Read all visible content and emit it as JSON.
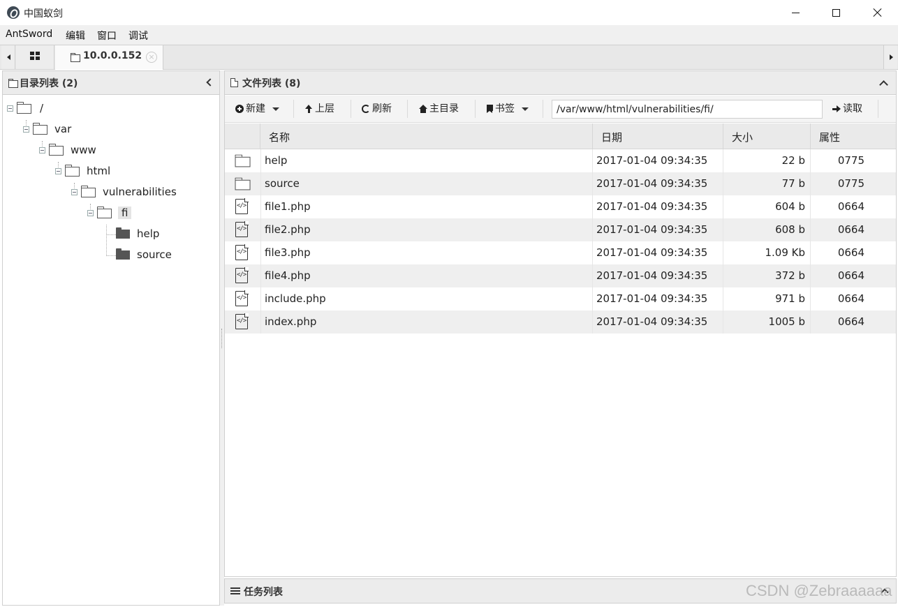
{
  "window": {
    "title": "中国蚁剑"
  },
  "menu": [
    "AntSword",
    "编辑",
    "窗口",
    "调试"
  ],
  "tabs": {
    "active_label": "10.0.0.152",
    "close_glyph": "×"
  },
  "left_panel": {
    "title": "目录列表 (2)",
    "tree": [
      {
        "label": "/",
        "depth": 0,
        "type": "folder-open"
      },
      {
        "label": "var",
        "depth": 1,
        "type": "folder-open"
      },
      {
        "label": "www",
        "depth": 2,
        "type": "folder-open"
      },
      {
        "label": "html",
        "depth": 3,
        "type": "folder-open"
      },
      {
        "label": "vulnerabilities",
        "depth": 4,
        "type": "folder-open"
      },
      {
        "label": "fi",
        "depth": 5,
        "type": "folder-open",
        "selected": true
      },
      {
        "label": "help",
        "depth": 6,
        "type": "folder-closed"
      },
      {
        "label": "source",
        "depth": 6,
        "type": "folder-closed"
      }
    ]
  },
  "right_panel": {
    "title": "文件列表 (8)",
    "toolbar": {
      "new_label": "新建",
      "up_label": "上层",
      "refresh_label": "刷新",
      "home_label": "主目录",
      "bookmark_label": "书签",
      "path_value": "/var/www/html/vulnerabilities/fi/",
      "read_label": "读取"
    },
    "columns": [
      "名称",
      "日期",
      "大小",
      "属性"
    ],
    "files": [
      {
        "name": "help",
        "date": "2017-01-04 09:34:35",
        "size": "22 b",
        "perm": "0775",
        "icon": "folder-icon"
      },
      {
        "name": "source",
        "date": "2017-01-04 09:34:35",
        "size": "77 b",
        "perm": "0775",
        "icon": "folder-icon"
      },
      {
        "name": "file1.php",
        "date": "2017-01-04 09:34:35",
        "size": "604 b",
        "perm": "0664",
        "icon": "code-file-icon"
      },
      {
        "name": "file2.php",
        "date": "2017-01-04 09:34:35",
        "size": "608 b",
        "perm": "0664",
        "icon": "code-file-icon"
      },
      {
        "name": "file3.php",
        "date": "2017-01-04 09:34:35",
        "size": "1.09 Kb",
        "perm": "0664",
        "icon": "code-file-icon"
      },
      {
        "name": "file4.php",
        "date": "2017-01-04 09:34:35",
        "size": "372 b",
        "perm": "0664",
        "icon": "code-file-icon"
      },
      {
        "name": "include.php",
        "date": "2017-01-04 09:34:35",
        "size": "971 b",
        "perm": "0664",
        "icon": "code-file-icon"
      },
      {
        "name": "index.php",
        "date": "2017-01-04 09:34:35",
        "size": "1005 b",
        "perm": "0664",
        "icon": "code-file-icon"
      }
    ]
  },
  "task_panel": {
    "title": "任务列表"
  },
  "watermark": "CSDN @Zebraaaaaa"
}
